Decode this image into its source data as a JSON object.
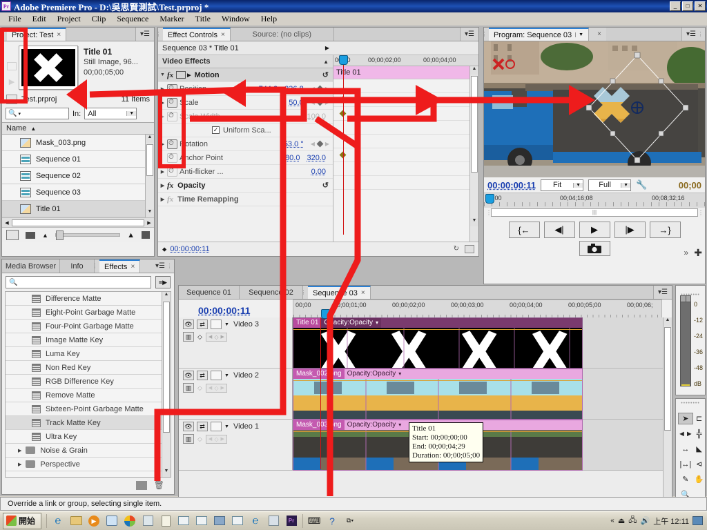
{
  "titlebar": {
    "app_icon": "premiere-pro-icon",
    "title": "Adobe Premiere Pro - D:\\吳思賢測試\\Test.prproj *",
    "minimize": "_",
    "maximize": "□",
    "close": "✕"
  },
  "menubar": {
    "items": [
      "File",
      "Edit",
      "Project",
      "Clip",
      "Sequence",
      "Marker",
      "Title",
      "Window",
      "Help"
    ]
  },
  "project": {
    "tab_label": "Project: Test",
    "tab_close": "×",
    "menu_icon": "panel-menu-icon",
    "preview": {
      "name": "Title 01",
      "type": "Still Image, 96...",
      "duration": "00;00;05;00"
    },
    "file_name": "Test.prproj",
    "item_count": "11 Items",
    "search_placeholder": "",
    "search_icon": "search-icon",
    "in_label": "In:",
    "in_value": "All",
    "column_header": "Name",
    "sort_arrow": "▲",
    "items": [
      {
        "label": "Mask_003.png",
        "icon": "image-icon",
        "selected": false
      },
      {
        "label": "Sequence 01",
        "icon": "sequence-icon",
        "selected": false
      },
      {
        "label": "Sequence 02",
        "icon": "sequence-icon",
        "selected": false
      },
      {
        "label": "Sequence 03",
        "icon": "sequence-icon",
        "selected": false
      },
      {
        "label": "Title 01",
        "icon": "image-icon",
        "selected": true
      }
    ]
  },
  "effect_controls": {
    "tab_label": "Effect Controls",
    "tab_close": "×",
    "source_tab_label": "Source: (no clips)",
    "sequence_line": "Sequence 03 * Title 01",
    "sequence_arrow": "▶",
    "section_title": "Video Effects",
    "collapse_arrow": "▲",
    "groups": [
      {
        "label": "Motion",
        "fx": "fx",
        "reset": "↺"
      },
      {
        "label": "Opacity",
        "fx": "fx",
        "reset": "↺"
      },
      {
        "label": "Time Remapping",
        "fx": "fx",
        "reset": ""
      }
    ],
    "properties": [
      {
        "label": "Position",
        "value1": "744.3",
        "value2": "336.8",
        "stopwatch": true,
        "keyframe": true,
        "dim": false
      },
      {
        "label": "Scale",
        "value1": "50.0",
        "value2": "",
        "stopwatch": true,
        "keyframe": true,
        "dim": false
      },
      {
        "label": "Scale Width",
        "value1": "100.0",
        "value2": "",
        "stopwatch": false,
        "keyframe": false,
        "dim": true
      },
      {
        "label": "Uniform Sca...",
        "value1": "",
        "value2": "",
        "checkbox": true,
        "checked": true,
        "dim": false
      },
      {
        "label": "Rotation",
        "value1": "53.0 °",
        "value2": "",
        "stopwatch": true,
        "keyframe": true,
        "dim": false
      },
      {
        "label": "Anchor Point",
        "value1": "480.0",
        "value2": "320.0",
        "stopwatch": true,
        "keyframe": false,
        "dim": false
      },
      {
        "label": "Anti-flicker ...",
        "value1": "0.00",
        "value2": "",
        "stopwatch": true,
        "keyframe": false,
        "dim": false
      }
    ],
    "ruler_labels": [
      "00;00",
      "00;00;02;00",
      "00;00;04;00"
    ],
    "clip_bar_label": "Title 01",
    "footer_timecode": "00:00:00:11"
  },
  "program_monitor": {
    "tab_label": "Program: Sequence 03",
    "tab_dropdown": "▼",
    "tab_close": "×",
    "menu_icon": "panel-menu-icon",
    "timecode": "00:00:00:11",
    "fit_value": "Fit",
    "quality_value": "Full",
    "wrench_icon": "settings-wrench-icon",
    "duration_timecode": "00;00",
    "ruler_labels": [
      "0;00",
      "00;04;16;08",
      "00;08;32;16"
    ],
    "buttons": [
      {
        "name": "mark-in-button",
        "glyph": "{←"
      },
      {
        "name": "step-back-button",
        "glyph": "◀|"
      },
      {
        "name": "play-button",
        "glyph": "▶"
      },
      {
        "name": "step-forward-button",
        "glyph": "|▶"
      },
      {
        "name": "mark-out-button",
        "glyph": "→}"
      }
    ],
    "export_frame": "camera-icon",
    "overflow": "»",
    "plus": "✚"
  },
  "effects_panel": {
    "tabs": [
      {
        "label": "Media Browser",
        "active": false
      },
      {
        "label": "Info",
        "active": false
      },
      {
        "label": "Effects",
        "active": true
      }
    ],
    "tab_close": "×",
    "menu_icon": "panel-menu-icon",
    "search_placeholder": "",
    "search_icon": "search-icon",
    "filter_icon": "filter-icon",
    "items": [
      {
        "label": "Difference Matte",
        "type": "effect",
        "selected": false
      },
      {
        "label": "Eight-Point Garbage Matte",
        "type": "effect",
        "selected": false
      },
      {
        "label": "Four-Point Garbage Matte",
        "type": "effect",
        "selected": false
      },
      {
        "label": "Image Matte Key",
        "type": "effect",
        "selected": false
      },
      {
        "label": "Luma Key",
        "type": "effect",
        "selected": false
      },
      {
        "label": "Non Red Key",
        "type": "effect",
        "selected": false
      },
      {
        "label": "RGB Difference Key",
        "type": "effect",
        "selected": false
      },
      {
        "label": "Remove Matte",
        "type": "effect",
        "selected": false
      },
      {
        "label": "Sixteen-Point Garbage Matte",
        "type": "effect",
        "selected": false
      },
      {
        "label": "Track Matte Key",
        "type": "effect",
        "selected": true
      },
      {
        "label": "Ultra Key",
        "type": "effect",
        "selected": false
      },
      {
        "label": "Noise & Grain",
        "type": "folder",
        "selected": false
      },
      {
        "label": "Perspective",
        "type": "folder",
        "selected": false
      }
    ],
    "new_bin_icon": "new-bin-icon",
    "delete_icon": "trash-icon"
  },
  "timeline": {
    "tabs": [
      {
        "label": "Sequence 01",
        "active": false
      },
      {
        "label": "Sequence 02",
        "active": false
      },
      {
        "label": "Sequence 03",
        "active": true
      }
    ],
    "tab_close": "×",
    "menu_icon": "panel-menu-icon",
    "timecode": "00:00:00:11",
    "snap_icon": "snap-magnet-icon",
    "marker_icon": "marker-icon",
    "add-marker_icon": "add-marker-icon",
    "ruler_labels": [
      "00;00",
      "00;00;01;00",
      "00;00;02;00",
      "00;00;03;00",
      "00;00;04;00",
      "00;00;05;00",
      "00;00;06;"
    ],
    "tracks": [
      {
        "name": "Video 3",
        "eye_icon": "eye-icon",
        "lock_icon": "toggle-sync-lock-icon",
        "clip_name": "Title 01",
        "clip_effect": "Opacity:Opacity",
        "clip_dropdown": "▾"
      },
      {
        "name": "Video 2",
        "eye_icon": "eye-icon",
        "lock_icon": "toggle-sync-lock-icon",
        "clip_name": "Mask_002.png",
        "clip_effect": "Opacity:Opacity",
        "clip_dropdown": "▾"
      },
      {
        "name": "Video 1",
        "eye_icon": "eye-icon",
        "lock_icon": "toggle-sync-lock-icon",
        "clip_name": "Mask_003.png",
        "clip_effect": "Opacity:Opacity",
        "clip_dropdown": "▾"
      }
    ]
  },
  "tooltip": {
    "title": "Title 01",
    "start": "Start: 00;00;00;00",
    "end": "End: 00;00;04;29",
    "duration": "Duration: 00;00;05;00"
  },
  "audio_meter": {
    "labels": [
      "0",
      "-12",
      "-24",
      "-36",
      "-48",
      "dB"
    ]
  },
  "tools": [
    {
      "name": "selection-tool",
      "glyph": "➤",
      "selected": true
    },
    {
      "name": "track-select-tool",
      "glyph": "⊏",
      "selected": false
    },
    {
      "name": "ripple-edit-tool",
      "glyph": "◄►",
      "selected": false
    },
    {
      "name": "rolling-edit-tool",
      "glyph": "╬",
      "selected": false
    },
    {
      "name": "rate-stretch-tool",
      "glyph": "↔",
      "selected": false
    },
    {
      "name": "razor-tool",
      "glyph": "◣",
      "selected": false
    },
    {
      "name": "slip-tool",
      "glyph": "|↔|",
      "selected": false
    },
    {
      "name": "slide-tool",
      "glyph": "⊲",
      "selected": false
    },
    {
      "name": "pen-tool",
      "glyph": "✎",
      "selected": false
    },
    {
      "name": "hand-tool",
      "glyph": "✋",
      "selected": false
    },
    {
      "name": "zoom-tool",
      "glyph": "🔍",
      "selected": false
    }
  ],
  "statusbar": {
    "message": "Override a link or group, selecting single item."
  },
  "taskbar": {
    "start_label": "開始",
    "start_icon": "windows-logo-icon",
    "items": [
      "ie-icon",
      "explorer-icon",
      "media-player-icon",
      "paint-icon",
      "photo-icon",
      "calculator-icon",
      "notepad-icon",
      "window-icon-1",
      "window-icon-2",
      "network-icon",
      "window-icon-3",
      "ie-icon-2",
      "app-icon",
      "premiere-icon"
    ],
    "tray_items": [
      "keyboard-icon",
      "help-icon",
      "network-icon"
    ],
    "tray_status": [
      "expand-icon",
      "safely-remove-icon",
      "network-icon",
      "volume-icon"
    ],
    "clock": "上午 12:11"
  }
}
